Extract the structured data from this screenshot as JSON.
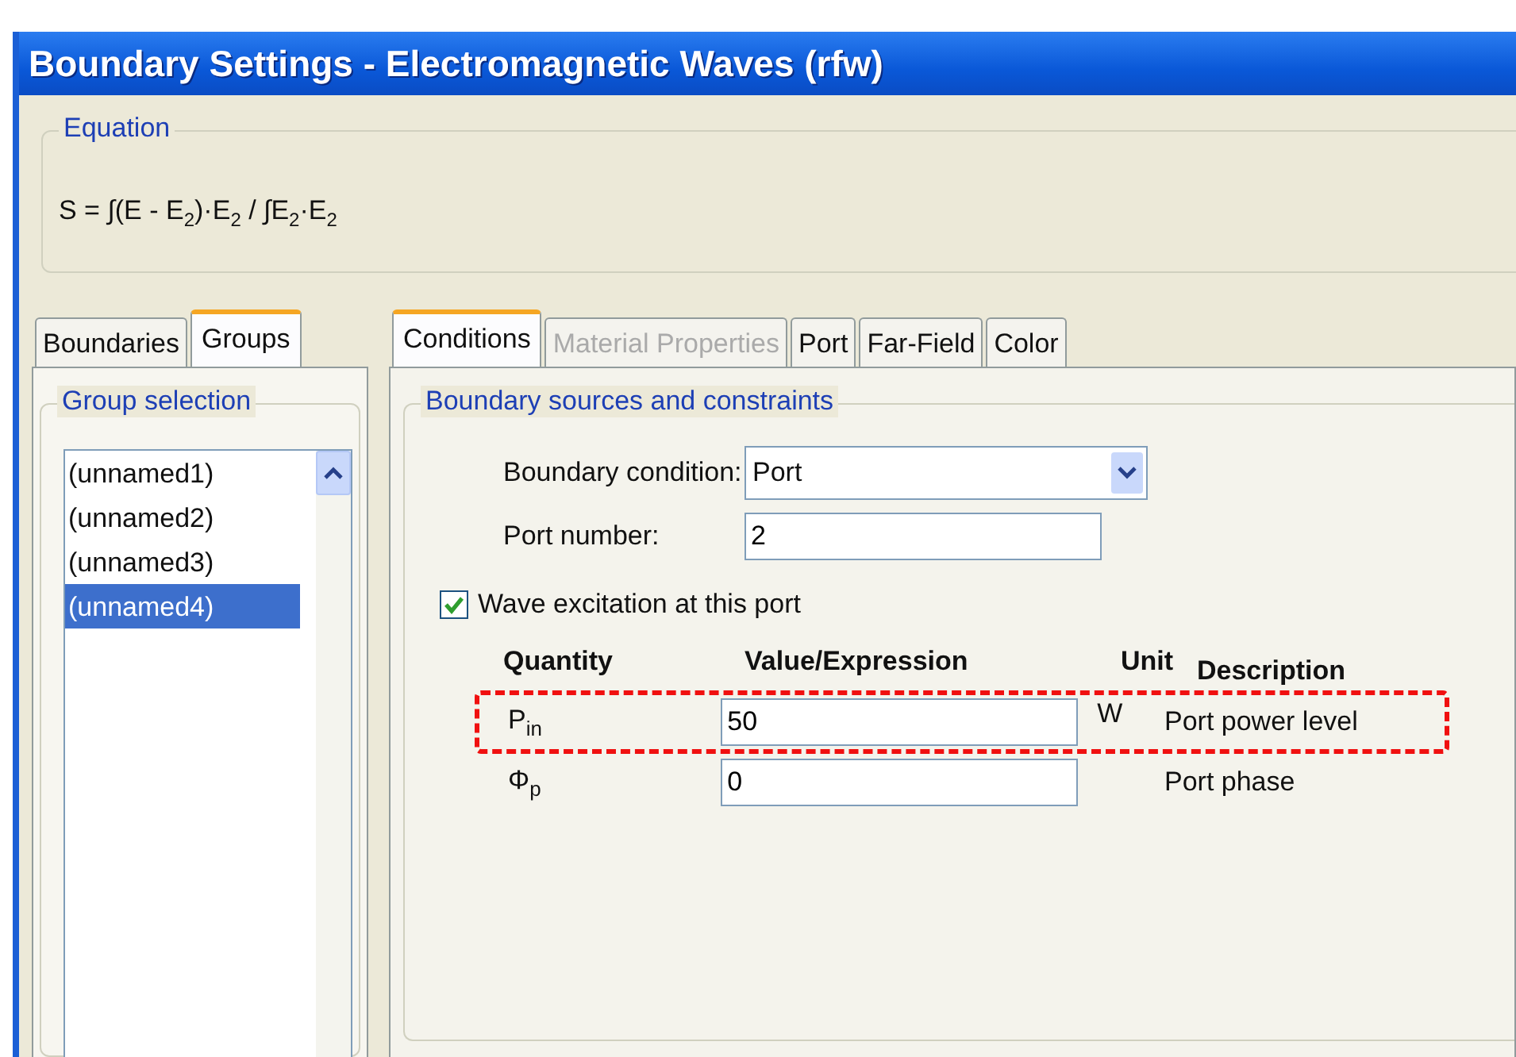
{
  "window": {
    "title": "Boundary Settings - Electromagnetic Waves (rfw)"
  },
  "equation": {
    "legend": "Equation",
    "formula": "S = ∫(E - E$_{2}$)·E$_{2}$ / ∫E$_{2}$·E$_{2}$"
  },
  "left_tabs": [
    {
      "label": "Boundaries",
      "selected": false
    },
    {
      "label": "Groups",
      "selected": true
    }
  ],
  "group_selection": {
    "legend": "Group selection",
    "items": [
      {
        "label": "(unnamed1)",
        "selected": false
      },
      {
        "label": "(unnamed2)",
        "selected": false
      },
      {
        "label": "(unnamed3)",
        "selected": false
      },
      {
        "label": "(unnamed4)",
        "selected": true
      }
    ]
  },
  "right_tabs": [
    {
      "label": "Conditions",
      "selected": true,
      "disabled": false
    },
    {
      "label": "Material Properties",
      "selected": false,
      "disabled": true
    },
    {
      "label": "Port",
      "selected": false,
      "disabled": false
    },
    {
      "label": "Far-Field",
      "selected": false,
      "disabled": false
    },
    {
      "label": "Color",
      "selected": false,
      "disabled": false
    }
  ],
  "conditions": {
    "legend": "Boundary sources and constraints",
    "boundary_condition": {
      "label": "Boundary condition:",
      "value": "Port"
    },
    "port_number": {
      "label": "Port number:",
      "value": "2"
    },
    "wave_excitation": {
      "label": "Wave excitation at this port",
      "checked": true
    },
    "table": {
      "columns": [
        "Quantity",
        "Value/Expression",
        "Unit",
        "Description"
      ],
      "rows": [
        {
          "quantity": "P$_{in}$",
          "value": "50",
          "unit": "W",
          "description": "Port power level",
          "highlighted": true
        },
        {
          "quantity": "Φ$_{p}$",
          "value": "0",
          "description": "Port phase",
          "highlighted": false
        }
      ]
    }
  }
}
